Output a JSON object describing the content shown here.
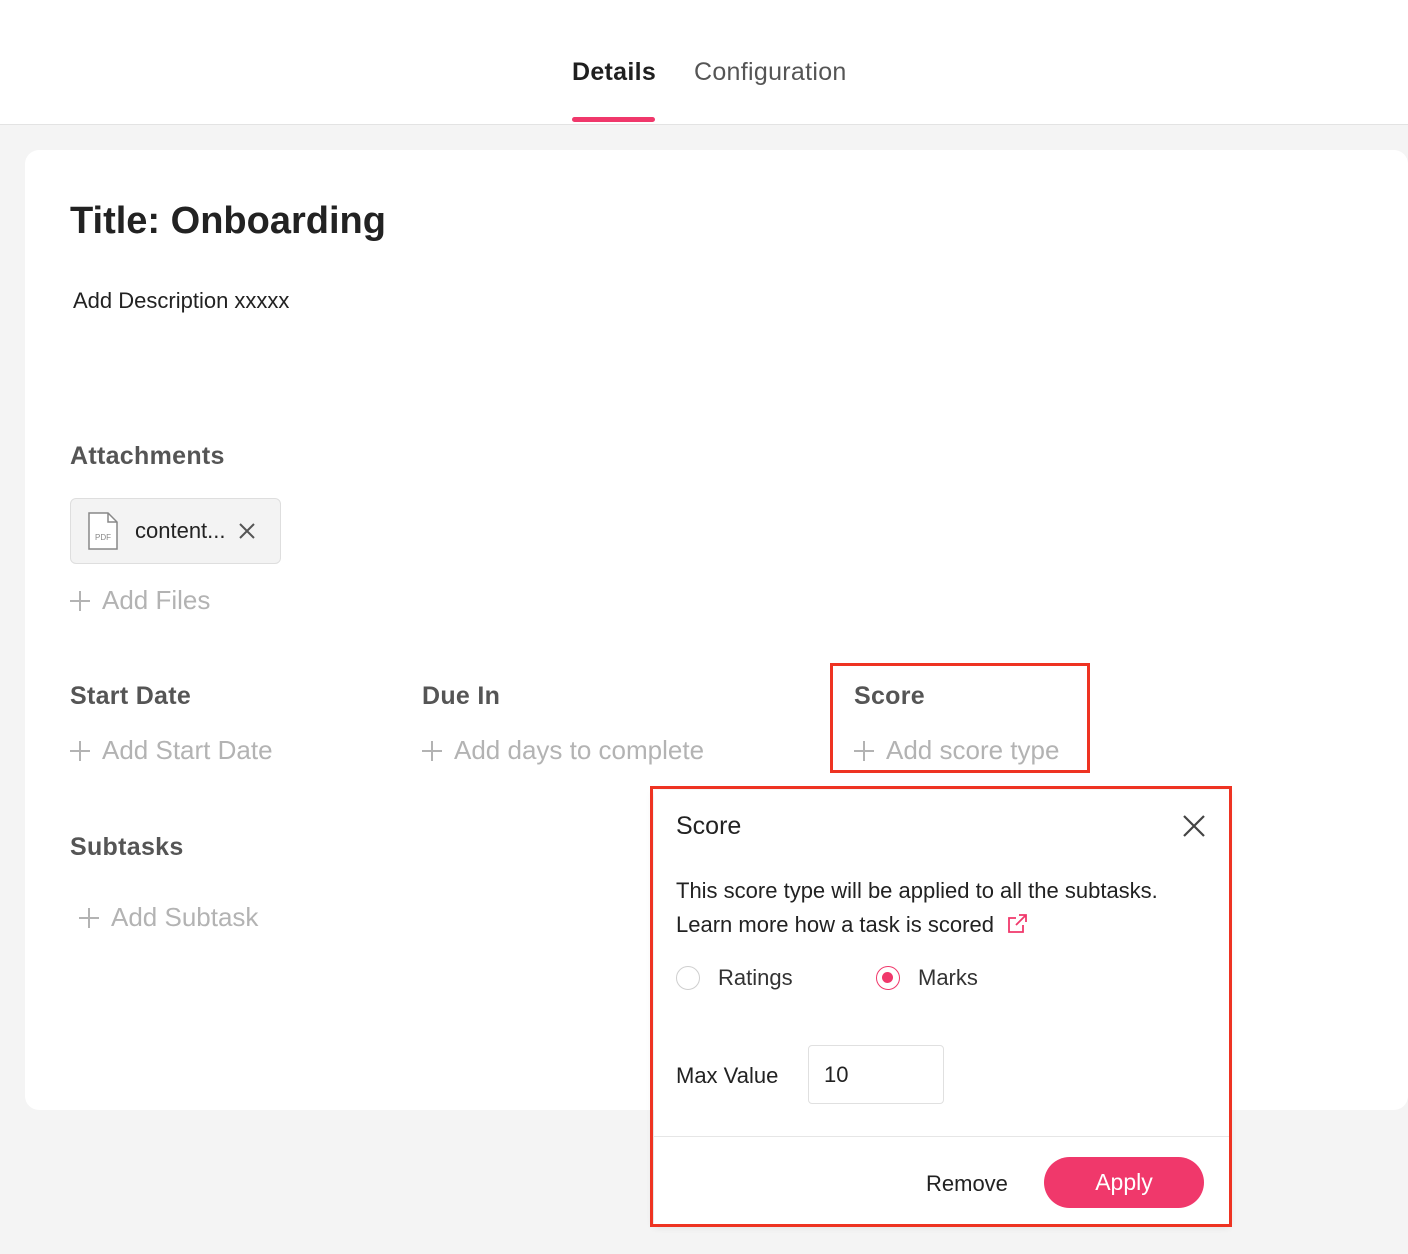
{
  "tabs": [
    {
      "label": "Details",
      "active": true
    },
    {
      "label": "Configuration",
      "active": false
    }
  ],
  "accent_color": "#f0386b",
  "task": {
    "title": "Title: Onboarding",
    "description": "Add Description xxxxx"
  },
  "attachments": {
    "label": "Attachments",
    "files": [
      {
        "name": "content...",
        "icon": "pdf-file-icon",
        "icon_text": "PDF"
      }
    ],
    "add_label": "Add Files"
  },
  "start_date": {
    "label": "Start Date",
    "add_label": "Add Start Date"
  },
  "due_in": {
    "label": "Due In",
    "add_label": "Add days to complete"
  },
  "score": {
    "label": "Score",
    "add_label": "Add score type"
  },
  "subtasks": {
    "label": "Subtasks",
    "add_label": "Add Subtask"
  },
  "score_popup": {
    "title": "Score",
    "description": "This score type will be applied to all the subtasks.",
    "learn_more": "Learn more how a task is scored",
    "options": [
      {
        "label": "Ratings",
        "selected": false
      },
      {
        "label": "Marks",
        "selected": true
      }
    ],
    "max_value_label": "Max Value",
    "max_value": "10",
    "remove_label": "Remove",
    "apply_label": "Apply"
  }
}
